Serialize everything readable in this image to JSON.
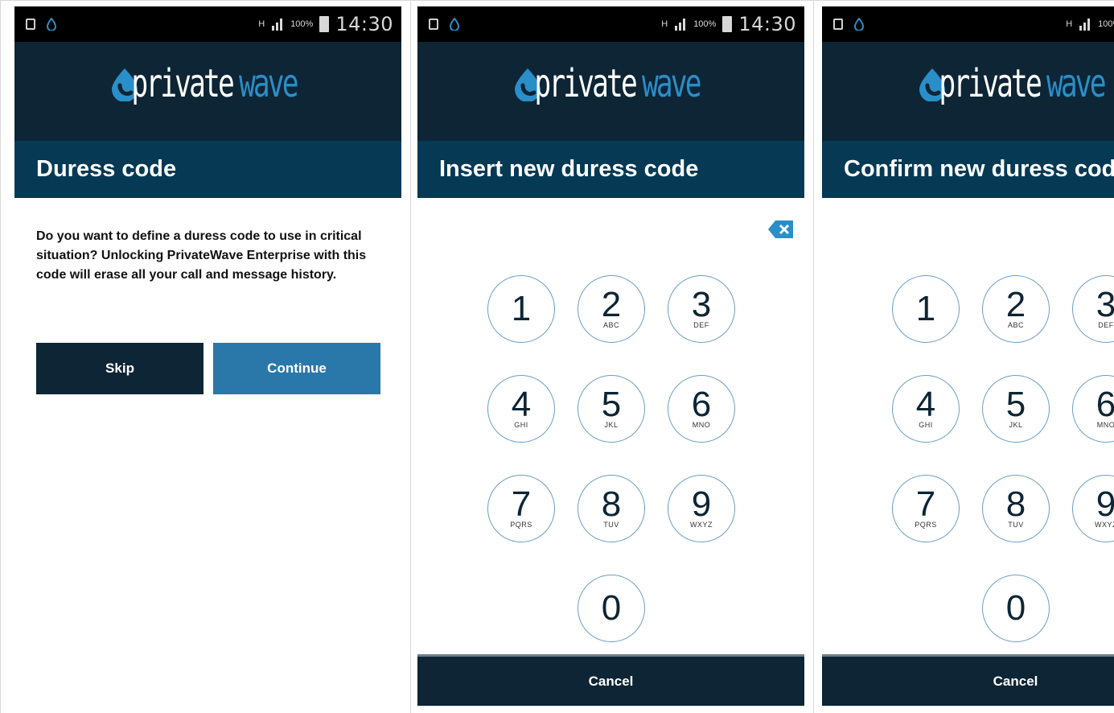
{
  "status": {
    "time": "14:30",
    "battery": "100%"
  },
  "logo": {
    "part1": "private",
    "part2": "wave"
  },
  "screens": [
    {
      "title": "Duress code",
      "description": "Do you want to define a duress code to use in critical situation? Unlocking PrivateWave Enterprise with this code will erase all your call and message history.",
      "skip_label": "Skip",
      "continue_label": "Continue"
    },
    {
      "title": "Insert new duress code",
      "cancel_label": "Cancel"
    },
    {
      "title": "Confirm new duress code",
      "cancel_label": "Cancel"
    }
  ],
  "keypad": [
    {
      "num": "1",
      "letters": ""
    },
    {
      "num": "2",
      "letters": "ABC"
    },
    {
      "num": "3",
      "letters": "DEF"
    },
    {
      "num": "4",
      "letters": "GHI"
    },
    {
      "num": "5",
      "letters": "JKL"
    },
    {
      "num": "6",
      "letters": "MNO"
    },
    {
      "num": "7",
      "letters": "PQRS"
    },
    {
      "num": "8",
      "letters": "TUV"
    },
    {
      "num": "9",
      "letters": "WXYZ"
    },
    {
      "num": "0",
      "letters": ""
    }
  ],
  "colors": {
    "header_bg": "#0d2535",
    "title_bg": "#063954",
    "accent": "#2a8ec8",
    "continue_bg": "#2a78aa",
    "key_border": "#6c9ec4"
  },
  "icons": [
    "gallery-icon",
    "privatewave-drop-icon",
    "network-icon",
    "signal-icon",
    "battery-icon",
    "backspace-icon"
  ]
}
